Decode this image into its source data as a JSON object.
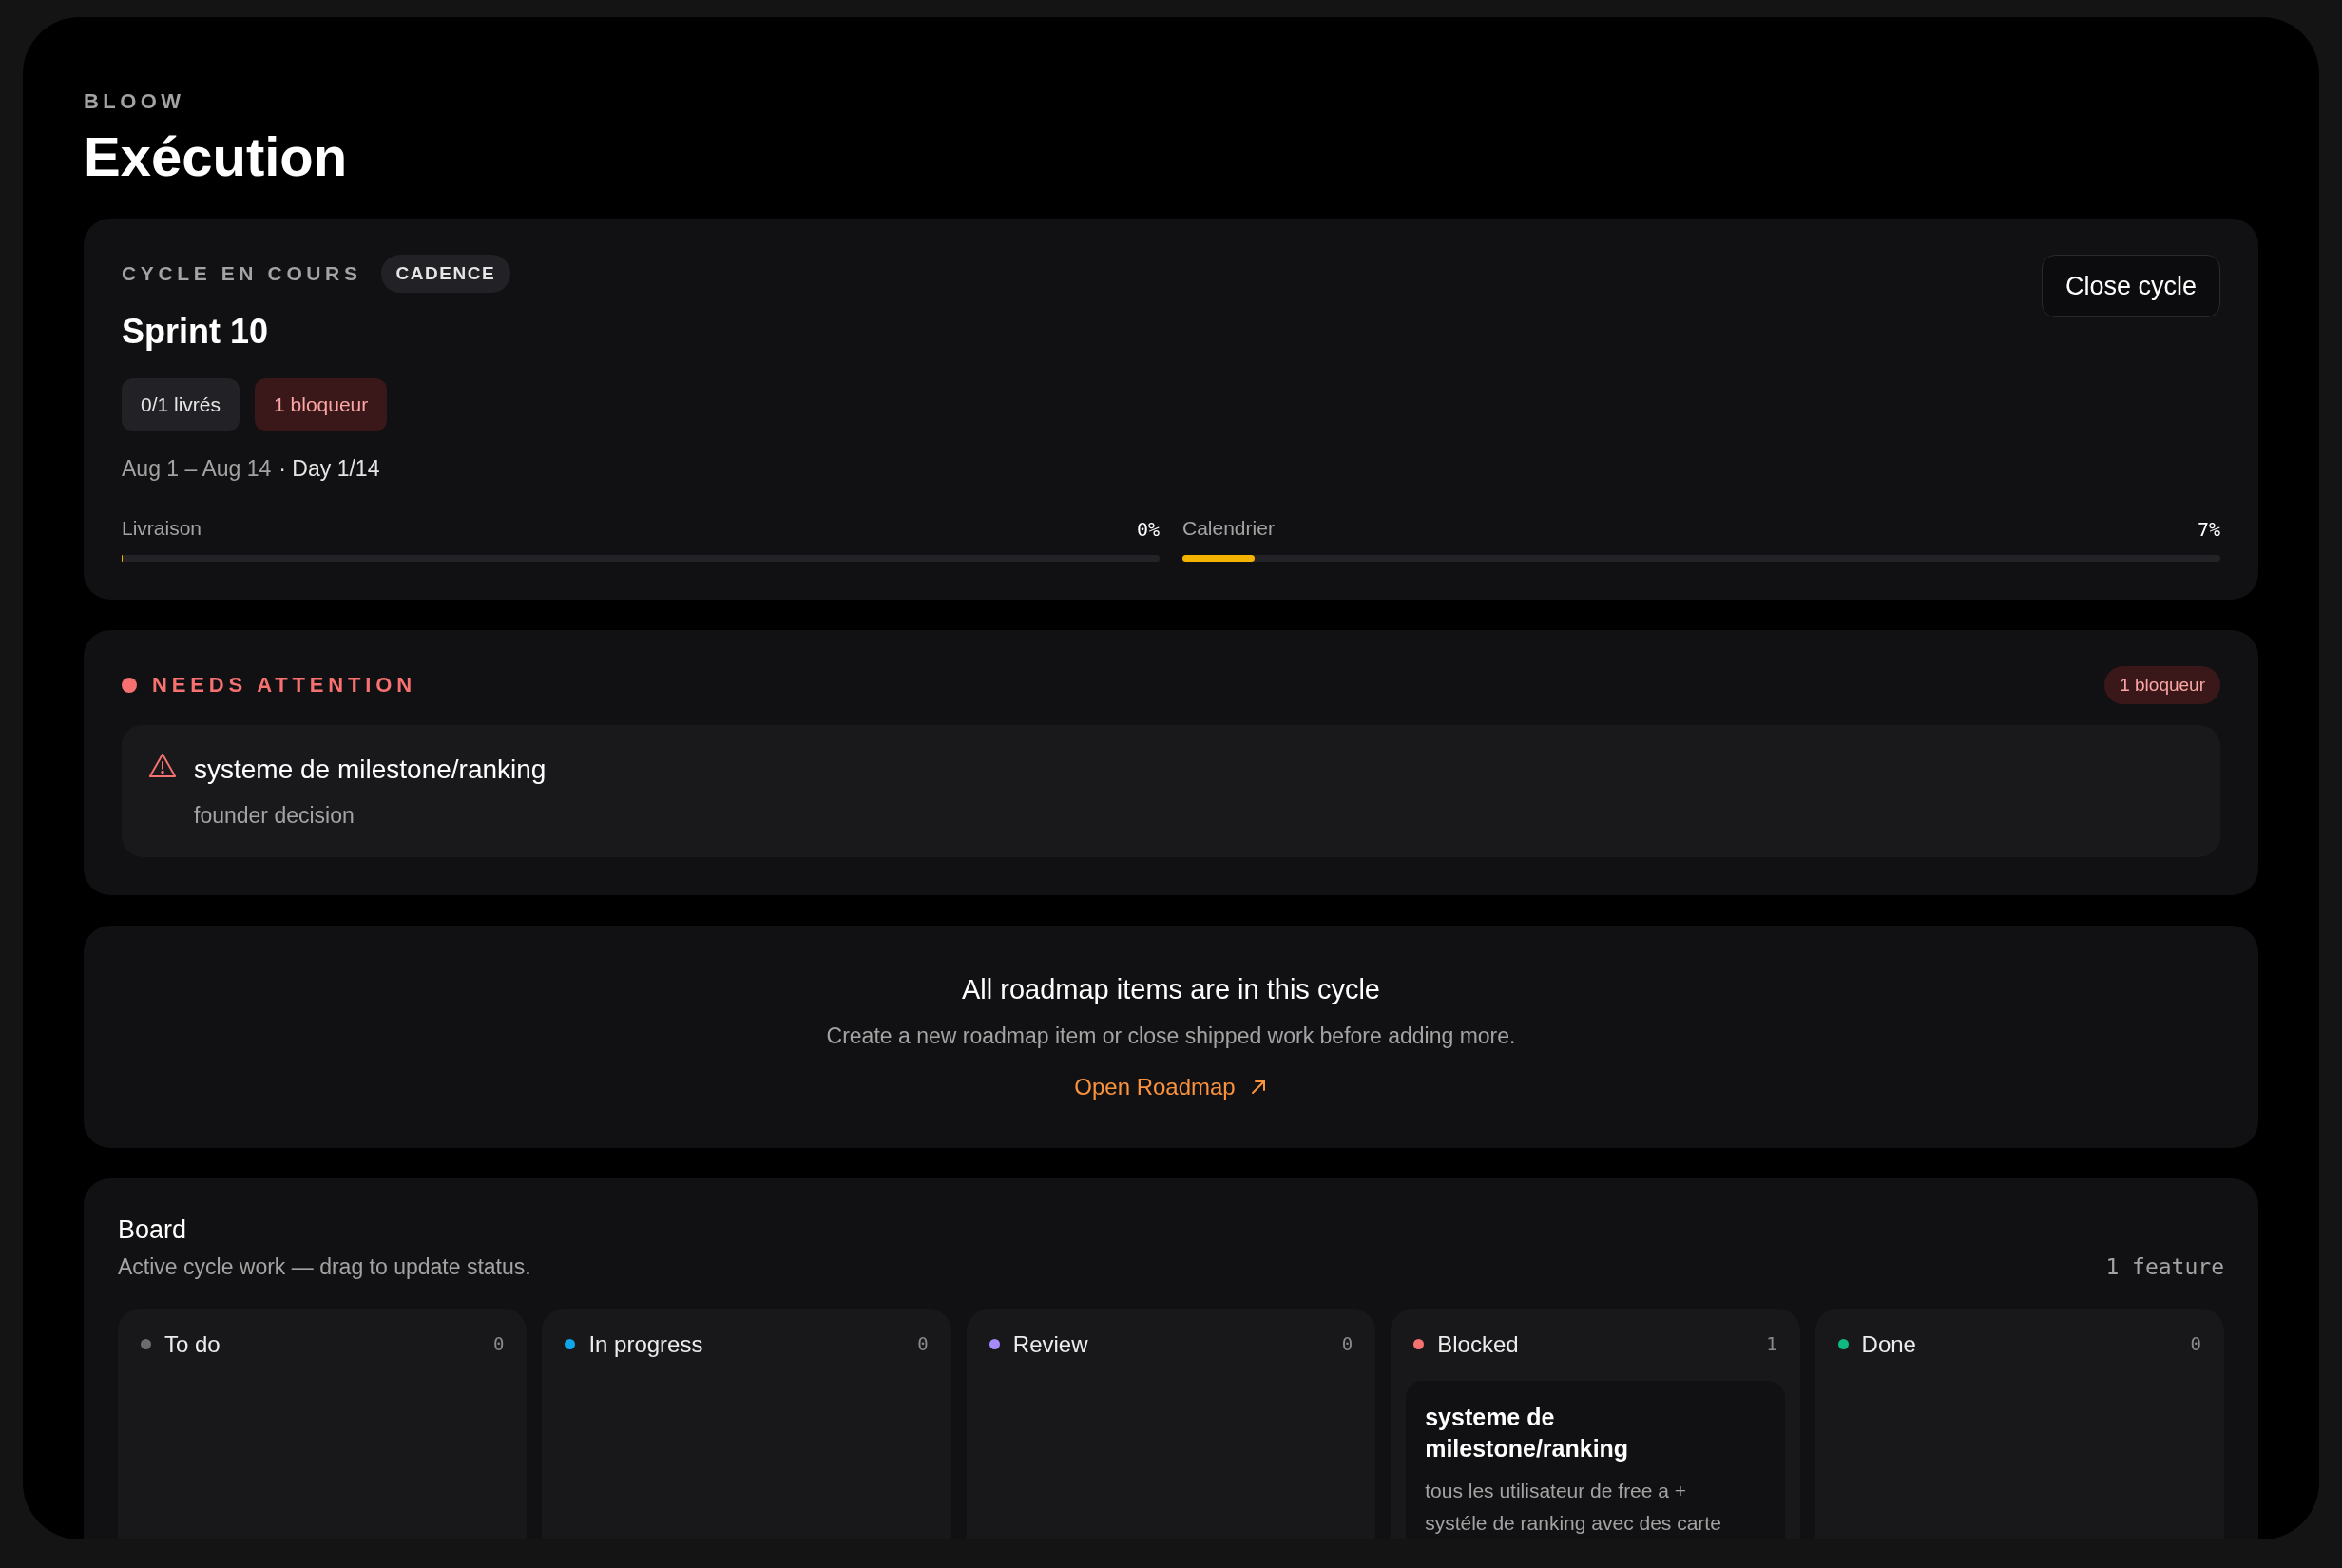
{
  "header": {
    "eyebrow": "BLOOW",
    "title": "Exécution"
  },
  "cycle": {
    "label": "CYCLE EN COURS",
    "tag": "CADENCE",
    "name": "Sprint 10",
    "close_button": "Close cycle",
    "chips": [
      {
        "text": "0/1 livrés",
        "kind": "neutral"
      },
      {
        "text": "1 bloqueur",
        "kind": "danger"
      }
    ],
    "dates": "Aug 1 – Aug 14",
    "day": "· Day 1/14",
    "progress": [
      {
        "label": "Livraison",
        "reading": "0%",
        "level": 0
      },
      {
        "label": "Calendrier",
        "reading": "7%",
        "level": 0.07
      }
    ]
  },
  "attention": {
    "title": "NEEDS ATTENTION",
    "badge": "1 bloqueur",
    "items": [
      {
        "title": "systeme de milestone/ranking",
        "subtitle": "founder decision"
      }
    ]
  },
  "empty_state": {
    "title": "All roadmap items are in this cycle",
    "text": "Create a new roadmap item or close shipped work before adding more.",
    "link": "Open Roadmap"
  },
  "board": {
    "title": "Board",
    "subtitle": "Active cycle work — drag to update status.",
    "count": "1 feature",
    "columns": [
      {
        "name": "To do",
        "count": "0",
        "color": "#6b6b70"
      },
      {
        "name": "In progress",
        "count": "0",
        "color": "#0ea5e9"
      },
      {
        "name": "Review",
        "count": "0",
        "color": "#a78bfa"
      },
      {
        "name": "Blocked",
        "count": "1",
        "color": "#f87171",
        "cards": [
          {
            "title": "systeme de milestone/ranking",
            "text": "tous les utilisateur de free a + systéle de ranking avec des carte"
          }
        ]
      },
      {
        "name": "Done",
        "count": "0",
        "color": "#10b981"
      }
    ]
  }
}
